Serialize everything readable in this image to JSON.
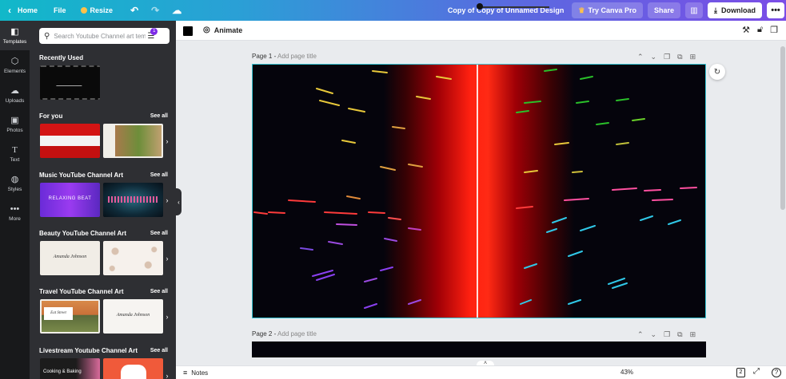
{
  "topbar": {
    "home": "Home",
    "file": "File",
    "resize": "Resize",
    "doc_title": "Copy of Copy of Unnamed Design",
    "try_pro": "Try Canva Pro",
    "share": "Share",
    "download": "Download",
    "icons": [
      "chevron-left-icon",
      "undo-icon",
      "redo-icon",
      "cloud-icon",
      "stats-icon",
      "download-icon",
      "more-icon"
    ]
  },
  "rail": {
    "items": [
      {
        "label": "Templates",
        "icon": "templates-icon"
      },
      {
        "label": "Elements",
        "icon": "elements-icon"
      },
      {
        "label": "Uploads",
        "icon": "upload-icon"
      },
      {
        "label": "Photos",
        "icon": "photo-icon"
      },
      {
        "label": "Text",
        "icon": "text-icon"
      },
      {
        "label": "Styles",
        "icon": "styles-icon"
      },
      {
        "label": "More",
        "icon": "more-dots-icon"
      }
    ]
  },
  "panel": {
    "search_placeholder": "Search Youtube Channel art templates",
    "filter_badge": "1",
    "sections": [
      {
        "title": "Recently Used",
        "see_all": ""
      },
      {
        "title": "For you",
        "see_all": "See all"
      },
      {
        "title": "Music YouTube Channel Art",
        "see_all": "See all"
      },
      {
        "title": "Beauty YouTube Channel Art",
        "see_all": "See all"
      },
      {
        "title": "Travel YouTube Channel Art",
        "see_all": "See all"
      },
      {
        "title": "Livestream Youtube Channel Art",
        "see_all": "See all"
      }
    ],
    "thumb_texts": {
      "music_1": "RELAXING BEAT",
      "beauty_1": "Amanda Johnson",
      "travel_1": "Eat Street",
      "travel_2": "Amanda Johnson",
      "live_1": "Cooking & Baking"
    }
  },
  "editor": {
    "animate": "Animate",
    "page1_label": "Page 1 -",
    "page1_add": "Add page title",
    "page2_label": "Page 2 -",
    "page2_add": "Add page title",
    "canvas_bg_colors": [
      "#05040c",
      "#ff2010"
    ]
  },
  "bottombar": {
    "notes": "Notes",
    "zoom": "43%",
    "pages_count": "2",
    "help": "?"
  }
}
